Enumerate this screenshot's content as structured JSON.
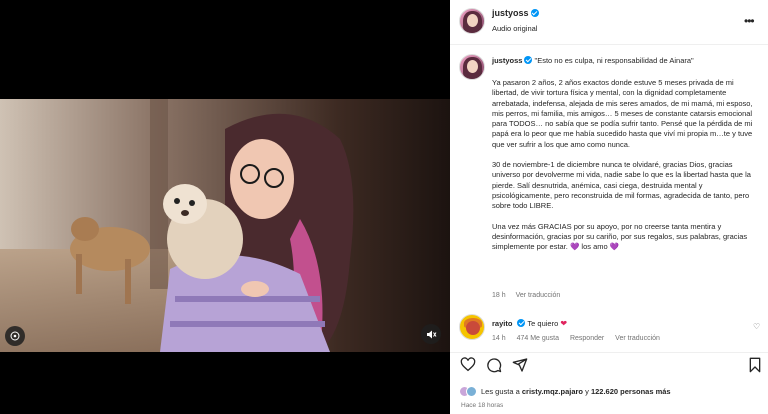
{
  "post": {
    "username": "justyoss",
    "audio": "Audio original"
  },
  "caption": {
    "username": "justyoss",
    "headline": "\"Esto no es culpa, ni responsabilidad de Ainara\"",
    "paragraphs": [
      "Ya pasaron 2 años, 2 años exactos donde estuve 5 meses privada de mi libertad, de vivir tortura física y mental, con la dignidad completamente arrebatada, indefensa, alejada de mis seres amados, de mi mamá, mi esposo, mis perros, mi familia, mis amigos… 5 meses de constante catarsis emocional para TODOS… no sabía que se podía sufrir tanto. Pensé que la pérdida de mi papá era lo peor que me había sucedido hasta que viví mi propia m…te y tuve que ver sufrir a los que amo como nunca.",
      "30 de noviembre-1 de diciembre nunca te olvidaré, gracias Dios, gracias universo por devolverme mi vida, nadie sabe lo que es la libertad hasta que la pierde. Salí desnutrida, anémica, casi ciega, destruida mental y psicológicamente, pero reconstruida de mil formas, agradecida de tanto, pero sobre todo LIBRE."
    ],
    "closing": "Una vez más GRACIAS por su apoyo, por no creerse tanta mentira y desinformación, gracias por su cariño, por sus regalos, sus palabras, gracias simplemente por estar.",
    "closing_end": "los amo",
    "heart": "💜",
    "time": "18 h",
    "translation": "Ver traducción"
  },
  "comment": {
    "username": "rayito",
    "text": "Te quiero",
    "heart": "❤",
    "time": "14 h",
    "likes": "474 Me gusta",
    "reply": "Responder",
    "translation": "Ver traducción"
  },
  "likes": {
    "prefix": "Les gusta a",
    "user": "cristy.mqz.pajaro",
    "middle": "y",
    "count": "122.620 personas más"
  },
  "timeago": "Hace 18 horas",
  "colors": {
    "verified": "#0095f6",
    "meta": "#737373",
    "text": "#262626"
  },
  "icons": [
    "more-icon",
    "heart-icon",
    "comment-icon",
    "share-icon",
    "bookmark-icon",
    "reel-icon",
    "mute-icon",
    "verified-icon"
  ]
}
